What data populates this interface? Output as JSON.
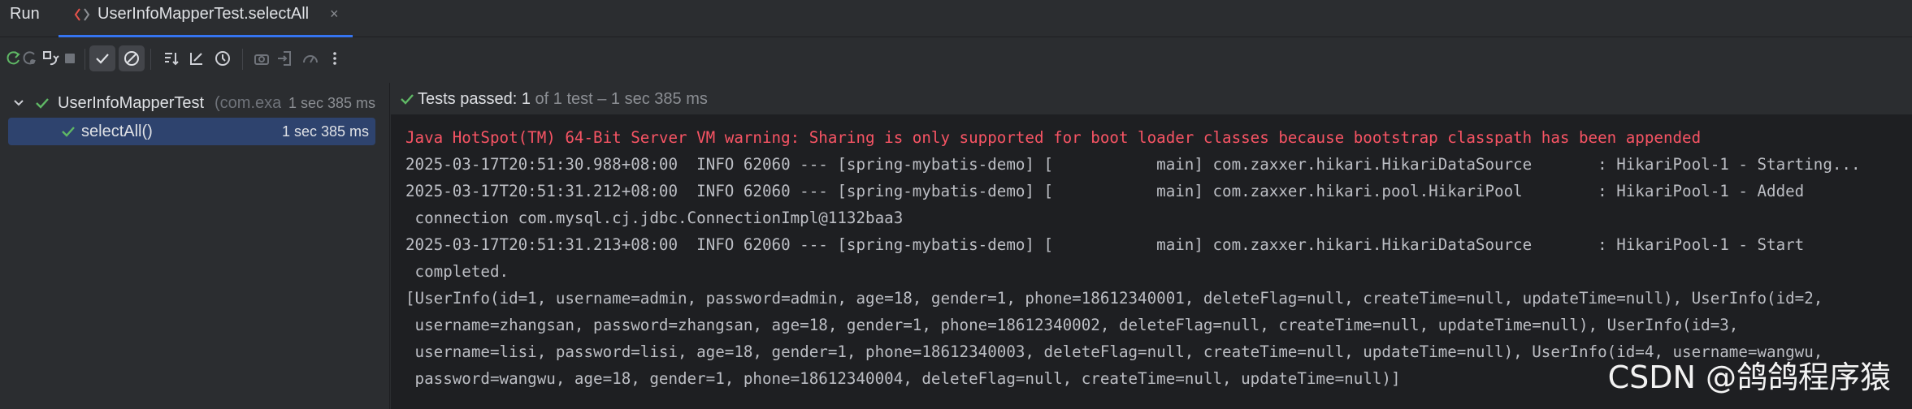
{
  "tabbar": {
    "run_title": "Run",
    "tab_label": "UserInfoMapperTest.selectAll",
    "close_glyph": "×"
  },
  "toolbar": {
    "buttons": [
      "rerun-icon",
      "rerun-failed-icon",
      "toggle-auto-test-icon",
      "stop-icon",
      "show-passed-icon",
      "show-ignored-icon",
      "sort-icon",
      "collapse-icon",
      "history-icon",
      "screenshot-icon",
      "import-icon",
      "coverage-icon",
      "more-icon"
    ]
  },
  "tree": {
    "root": {
      "label": "UserInfoMapperTest",
      "package": "(com.example",
      "duration": "1 sec 385 ms"
    },
    "child": {
      "label": "selectAll()",
      "duration": "1 sec 385 ms"
    }
  },
  "status": {
    "passed_label": "Tests passed: 1",
    "detail": " of 1 test – 1 sec 385 ms"
  },
  "console": {
    "lines": [
      "Java HotSpot(TM) 64-Bit Server VM warning: Sharing is only supported for boot loader classes because bootstrap classpath has been appended",
      "2025-03-17T20:51:30.988+08:00  INFO 62060 --- [spring-mybatis-demo] [           main] com.zaxxer.hikari.HikariDataSource       : HikariPool-1 - Starting...",
      "2025-03-17T20:51:31.212+08:00  INFO 62060 --- [spring-mybatis-demo] [           main] com.zaxxer.hikari.pool.HikariPool        : HikariPool-1 - Added",
      " connection com.mysql.cj.jdbc.ConnectionImpl@1132baa3",
      "2025-03-17T20:51:31.213+08:00  INFO 62060 --- [spring-mybatis-demo] [           main] com.zaxxer.hikari.HikariDataSource       : HikariPool-1 - Start",
      " completed.",
      "[UserInfo(id=1, username=admin, password=admin, age=18, gender=1, phone=18612340001, deleteFlag=null, createTime=null, updateTime=null), UserInfo(id=2,",
      " username=zhangsan, password=zhangsan, age=18, gender=1, phone=18612340002, deleteFlag=null, createTime=null, updateTime=null), UserInfo(id=3,",
      " username=lisi, password=lisi, age=18, gender=1, phone=18612340003, deleteFlag=null, createTime=null, updateTime=null), UserInfo(id=4, username=wangwu,",
      " password=wangwu, age=18, gender=1, phone=18612340004, deleteFlag=null, createTime=null, updateTime=null)]"
    ]
  },
  "watermark": "CSDN @鸽鸽程序猿",
  "colors": {
    "accent": "#3574f0",
    "pass_green": "#5fb865",
    "error_red": "#f75464",
    "selection": "#2e436e"
  }
}
